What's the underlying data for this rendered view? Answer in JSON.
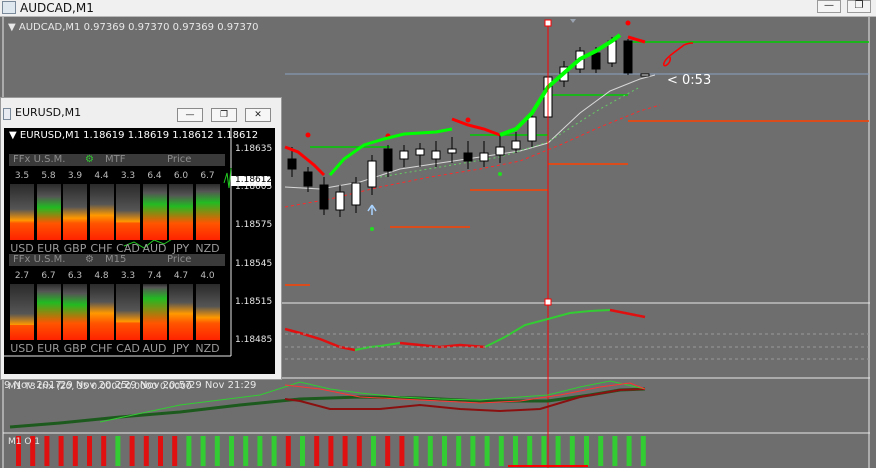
{
  "window": {
    "title": "AUDCAD,M1",
    "buttons": {
      "minimize": "—",
      "maximize": "❐",
      "close": "✕"
    }
  },
  "main_chart": {
    "info": "▼ AUDCAD,M1  0.97369 0.97370 0.97369 0.97370",
    "time_readout": "< 0:53",
    "trix_label": "M1 T3 trix (20, 35 0.0000 0.0000 0.0000",
    "mo_label": "M1 O 1",
    "mo_histogram": [
      "r",
      "r",
      "r",
      "r",
      "r",
      "r",
      "r",
      "g",
      "r",
      "r",
      "r",
      "r",
      "g",
      "g",
      "g",
      "g",
      "g",
      "g",
      "g",
      "r",
      "g",
      "r",
      "r",
      "r",
      "r",
      "g",
      "r",
      "r",
      "g",
      "g",
      "g",
      "g",
      "g",
      "g",
      "g",
      "g",
      "g",
      "g",
      "g",
      "g",
      "g",
      "g",
      "g",
      "g",
      "g"
    ],
    "colors": {
      "up_line": "#00ff00",
      "down_line": "#ff0000",
      "level": "#ff4000",
      "crosshair": "#ff0000"
    }
  },
  "eurusd_window": {
    "title": "EURUSD,M1",
    "info": "▼ EURUSD,M1  1.18619 1.18619 1.18612 1.18612",
    "price_axis": [
      "1.18635",
      "1.18605",
      "1.18575",
      "1.18545",
      "1.18515",
      "1.18485"
    ],
    "current_price": "1.18612",
    "time_axis": [
      "9 Nov 2017",
      "29 Nov 20:25",
      "29 Nov 20:57",
      "29 Nov 21:29"
    ],
    "panels": [
      {
        "header": {
          "left": "FFx U.S.M.",
          "mid": "MTF",
          "right": "Price"
        },
        "values": [
          "3.5",
          "5.8",
          "3.9",
          "4.4",
          "3.3",
          "6.4",
          "6.0",
          "6.7"
        ],
        "levels": [
          0.35,
          0.58,
          0.39,
          0.44,
          0.33,
          0.64,
          0.6,
          0.67
        ]
      },
      {
        "header": {
          "left": "FFx U.S.M.",
          "mid": "M15",
          "right": "Price"
        },
        "values": [
          "2.7",
          "6.7",
          "6.3",
          "4.8",
          "3.3",
          "7.4",
          "4.7",
          "4.0"
        ],
        "levels": [
          0.27,
          0.67,
          0.63,
          0.48,
          0.33,
          0.74,
          0.47,
          0.4
        ]
      }
    ],
    "currencies": [
      "USD",
      "EUR",
      "GBP",
      "CHF",
      "CAD",
      "AUD",
      "JPY",
      "NZD"
    ]
  }
}
